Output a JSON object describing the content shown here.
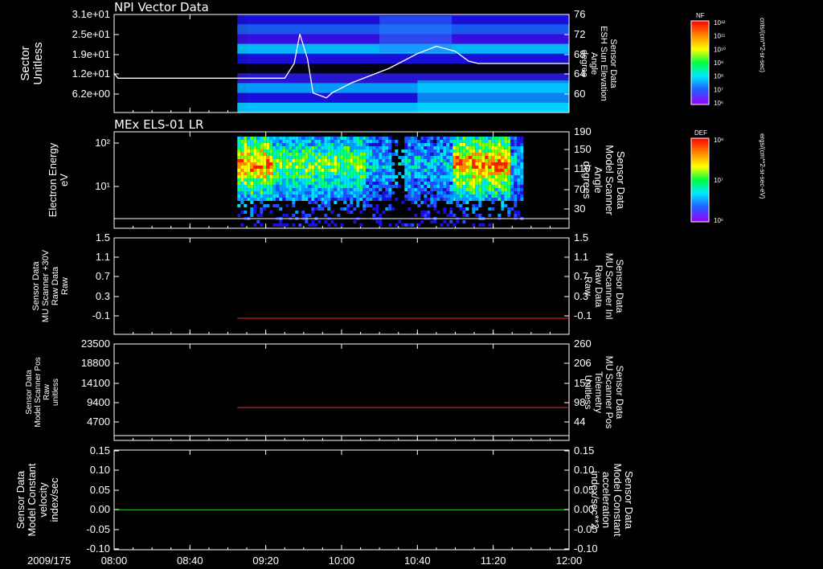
{
  "chart_data": {
    "type": "multi-panel time series",
    "date_label": "2009/175",
    "x_ticks": [
      "08:00",
      "08:40",
      "09:20",
      "10:00",
      "10:40",
      "11:20",
      "12:00"
    ],
    "panels": [
      {
        "id": "npi",
        "type": "heatmap+line",
        "title": "NPI Vector Data",
        "left_ylabel": [
          "Sector",
          "Unitless"
        ],
        "left_ticks": [
          "3.1e+01",
          "2.5e+01",
          "1.9e+01",
          "1.2e+01",
          "6.2e+00"
        ],
        "right_ylabel": [
          "Sensor Data",
          "ESH Sun Elevation",
          "Angle",
          "degree"
        ],
        "right_ticks": [
          "76",
          "72",
          "68",
          "64",
          "60"
        ],
        "right_ylim": [
          56,
          76
        ],
        "data_start": "09:05",
        "line_series": {
          "color": "#ffffff",
          "x": [
            "08:00",
            "08:02",
            "09:30",
            "09:35",
            "09:38",
            "09:42",
            "09:45",
            "09:52",
            "09:55",
            "10:05",
            "10:25",
            "10:40",
            "10:50",
            "11:00",
            "11:07",
            "11:12",
            "11:15",
            "12:00"
          ],
          "y": [
            64.0,
            63.0,
            63.0,
            66.0,
            72.0,
            67.0,
            60.0,
            59.0,
            60.0,
            62.0,
            65.0,
            68.0,
            69.5,
            68.5,
            66.5,
            66.0,
            66.0,
            66.0
          ]
        },
        "colorbar": {
          "title": "NF",
          "ticks": [
            "10¹²",
            "10¹¹",
            "10¹⁰",
            "10⁹",
            "10⁸",
            "10⁷",
            "10⁶"
          ],
          "label": "cnts/(cm**2-sr-sec)"
        }
      },
      {
        "id": "els",
        "type": "heatmap+line",
        "title": "MEx ELS-01 LR",
        "left_ylabel": [
          "Electron Energy",
          "eV"
        ],
        "left_ticks": [
          "10²",
          "10¹"
        ],
        "right_ylabel": [
          "Sensor Data",
          "Model Scanner",
          "Angle",
          "degrees"
        ],
        "right_ticks": [
          "190",
          "150",
          "110",
          "70",
          "30"
        ],
        "right_ylim": [
          0,
          190
        ],
        "data_start": "09:05",
        "data_end": "11:35",
        "line_series": {
          "color": "#ffffff",
          "value": 0
        },
        "colorbar": {
          "title": "DEF",
          "ticks": [
            "10⁸",
            "10⁷",
            "10⁶"
          ],
          "label": "ergs/(cm**2-sr-sec-eV)"
        }
      },
      {
        "id": "mu-inl",
        "type": "line",
        "left_ylabel": [
          "Sensor Data",
          "MU Scanner +30V",
          "Raw Data",
          "Raw"
        ],
        "left_ticks": [
          "1.5",
          "1.1",
          "0.7",
          "0.3",
          "-0.1"
        ],
        "right_ylabel": [
          "Sensor Data",
          "MU Scanner Inl",
          "Raw Data",
          "Raw"
        ],
        "right_ticks": [
          "1.5",
          "1.1",
          "0.7",
          "0.3",
          "-0.1"
        ],
        "ylim": [
          -0.3,
          1.5
        ],
        "right_label_color": "#ff2020",
        "series": [
          {
            "color": "#ff2020",
            "x_start": "09:05",
            "x_end": "12:00",
            "value": 0.0
          }
        ]
      },
      {
        "id": "model-scanner-pos",
        "type": "line",
        "left_ylabel": [
          "Sensor Data",
          "Model Scanner Pos",
          "Raw",
          "unitless"
        ],
        "left_ticks": [
          "23500",
          "18800",
          "14100",
          "9400",
          "4700"
        ],
        "right_ylabel": [
          "Sensor Data",
          "MU Scanner Pos",
          "Telemetry",
          "Unitless"
        ],
        "right_ticks": [
          "260",
          "206",
          "152",
          "98",
          "44"
        ],
        "right_ylim": [
          0,
          260
        ],
        "right_label_color": "#ff2020",
        "series": [
          {
            "color": "#ff2020",
            "x_start": "09:05",
            "x_end": "12:00",
            "value": 8200
          }
        ]
      },
      {
        "id": "model-constant",
        "type": "line",
        "left_ylabel": [
          "Sensor Data",
          "Model Constant",
          "velocity",
          "index/sec"
        ],
        "left_ticks": [
          "0.15",
          "0.10",
          "0.05",
          "0.00",
          "-0.05",
          "-0.10"
        ],
        "right_ylabel": [
          "Sensor Data",
          "Model Constant",
          "acceleration",
          "index/sec**2"
        ],
        "right_ticks": [
          "0.15",
          "0.10",
          "0.05",
          "0.00",
          "-0.05",
          "-0.10"
        ],
        "ylim": [
          -0.1,
          0.15
        ],
        "right_label_color": "#22dd22",
        "series": [
          {
            "color": "#22dd22",
            "x_start": "08:00",
            "x_end": "12:00",
            "value": 0.0
          }
        ]
      }
    ]
  }
}
